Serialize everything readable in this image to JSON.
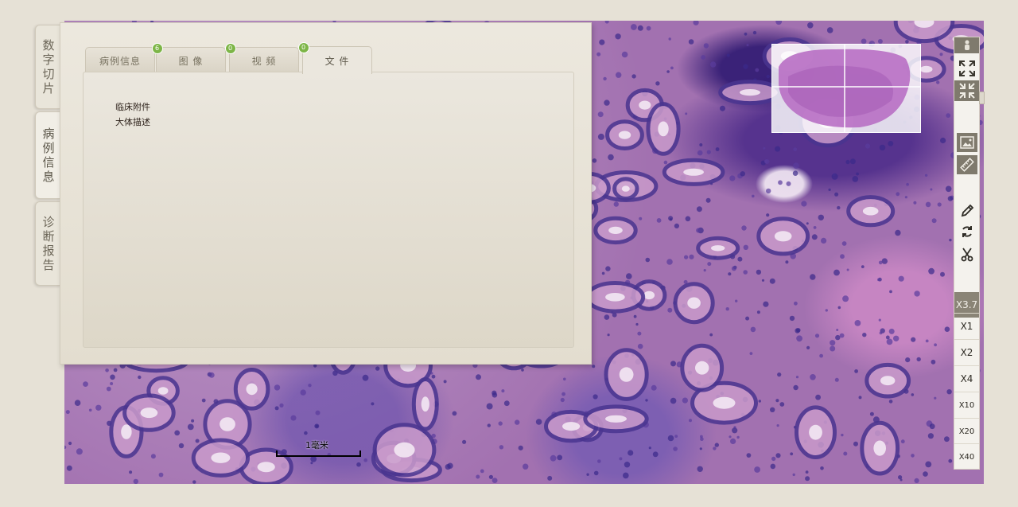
{
  "left_tabs": [
    {
      "label": "数字切片"
    },
    {
      "label": "病例信息"
    },
    {
      "label": "诊断报告"
    }
  ],
  "panel": {
    "tabs": [
      {
        "label": "病例信息",
        "badge": ""
      },
      {
        "label": "图 像",
        "badge": "6"
      },
      {
        "label": "视 频",
        "badge": "0"
      },
      {
        "label": "文 件",
        "badge": "0"
      }
    ],
    "active_tab": "文 件",
    "files": [
      "临床附件",
      "大体描述"
    ]
  },
  "toolbar": {
    "icons": [
      "person-icon",
      "expand-icon",
      "collapse-icon",
      "side-handle-icon",
      "image-icon",
      "ruler-icon",
      "pencil-icon",
      "rotate-icon",
      "scissors-icon"
    ],
    "current_zoom": "X3.7",
    "zoom_levels": [
      "X1",
      "X2",
      "X4",
      "X10",
      "X20",
      "X40"
    ]
  },
  "scale": {
    "label": "1毫米"
  },
  "colors": {
    "badge": "#7db547",
    "tissue": "#a271b0",
    "panel": "#e9e5da"
  }
}
